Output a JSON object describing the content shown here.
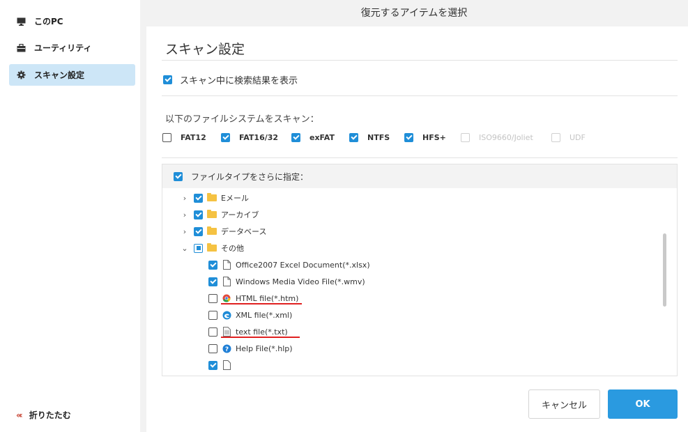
{
  "sidebar": {
    "items": [
      {
        "label": "このPC",
        "icon": "monitor-icon"
      },
      {
        "label": "ユーティリティ",
        "icon": "toolbox-icon"
      },
      {
        "label": "スキャン設定",
        "icon": "gear-icon",
        "active": true
      }
    ],
    "collapse_label": "折りたたむ"
  },
  "header": {
    "title": "復元するアイテムを選択"
  },
  "main": {
    "section_title": "スキャン設定",
    "show_results_option": {
      "label": "スキャン中に検索結果を表示",
      "checked": true
    },
    "fs_label": "以下のファイルシステムをスキャン：",
    "filesystems": [
      {
        "label": "FAT12",
        "checked": false,
        "enabled": true
      },
      {
        "label": "FAT16/32",
        "checked": true,
        "enabled": true
      },
      {
        "label": "exFAT",
        "checked": true,
        "enabled": true
      },
      {
        "label": "NTFS",
        "checked": true,
        "enabled": true
      },
      {
        "label": "HFS+",
        "checked": true,
        "enabled": true
      },
      {
        "label": "ISO9660/Joliet",
        "checked": false,
        "enabled": false
      },
      {
        "label": "UDF",
        "checked": false,
        "enabled": false
      }
    ],
    "filetype": {
      "header_label": "ファイルタイプをさらに指定：",
      "header_checked": true,
      "folders": [
        {
          "label": "Eメール",
          "state": "checked",
          "expanded": false
        },
        {
          "label": "アーカイブ",
          "state": "checked",
          "expanded": false
        },
        {
          "label": "データベース",
          "state": "checked",
          "expanded": false
        },
        {
          "label": "その他",
          "state": "partial",
          "expanded": true
        }
      ],
      "files": [
        {
          "label": "Office2007 Excel Document(*.xlsx)",
          "checked": true,
          "icon": "document-icon"
        },
        {
          "label": "Windows Media Video File(*.wmv)",
          "checked": true,
          "icon": "document-icon"
        },
        {
          "label": "HTML file(*.htm)",
          "checked": false,
          "icon": "chrome-icon",
          "underlined": true
        },
        {
          "label": "XML file(*.xml)",
          "checked": false,
          "icon": "edge-icon"
        },
        {
          "label": "text file(*.txt)",
          "checked": false,
          "icon": "text-file-icon",
          "underlined": true
        },
        {
          "label": "Help File(*.hlp)",
          "checked": false,
          "icon": "help-icon"
        }
      ]
    }
  },
  "buttons": {
    "cancel": "キャンセル",
    "ok": "OK"
  },
  "colors": {
    "accent": "#2a9ae0",
    "checkbox": "#1f8ed8",
    "active_nav": "#cde6f7",
    "underline": "#e02020"
  }
}
